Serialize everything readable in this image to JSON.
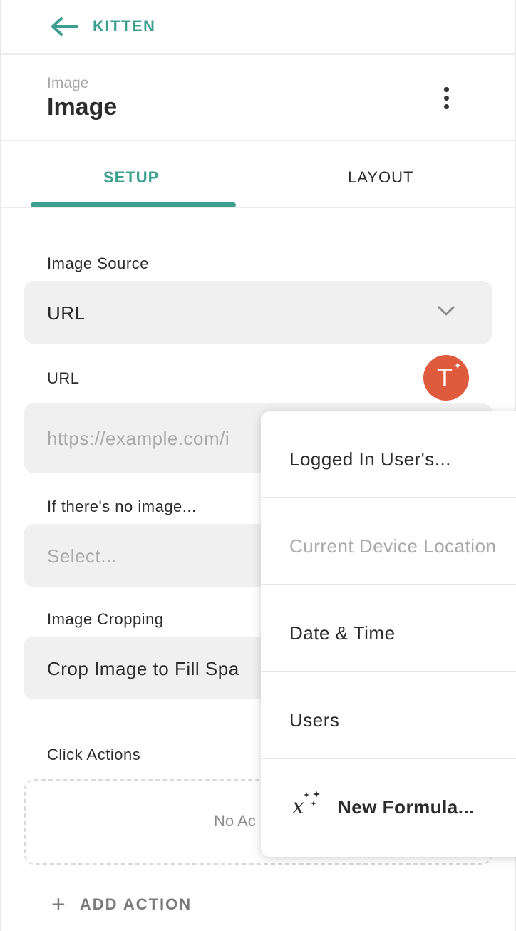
{
  "nav": {
    "back_label": "KITTEN"
  },
  "header": {
    "subtitle": "Image",
    "title": "Image"
  },
  "tabs": [
    {
      "label": "SETUP"
    },
    {
      "label": "LAYOUT"
    }
  ],
  "form": {
    "image_source": {
      "label": "Image Source",
      "value": "URL"
    },
    "url": {
      "label": "URL",
      "placeholder": "https://example.com/i"
    },
    "no_image": {
      "label": "If there's no image...",
      "placeholder": "Select..."
    },
    "cropping": {
      "label": "Image Cropping",
      "value": "Crop Image to Fill Spa"
    },
    "click_actions": {
      "label": "Click Actions",
      "empty_text": "No Ac"
    },
    "add_action_label": "ADD ACTION"
  },
  "magic_button": {
    "letter": "T"
  },
  "menu": {
    "items": [
      {
        "label": "Logged In User's..."
      },
      {
        "label": "Current Device Location"
      },
      {
        "label": "Date & Time"
      },
      {
        "label": "Users"
      },
      {
        "label": "New Formula..."
      }
    ]
  },
  "colors": {
    "accent": "#3c9f90",
    "avatar": "#e05a3e",
    "field_bg": "#f0f0f0"
  }
}
